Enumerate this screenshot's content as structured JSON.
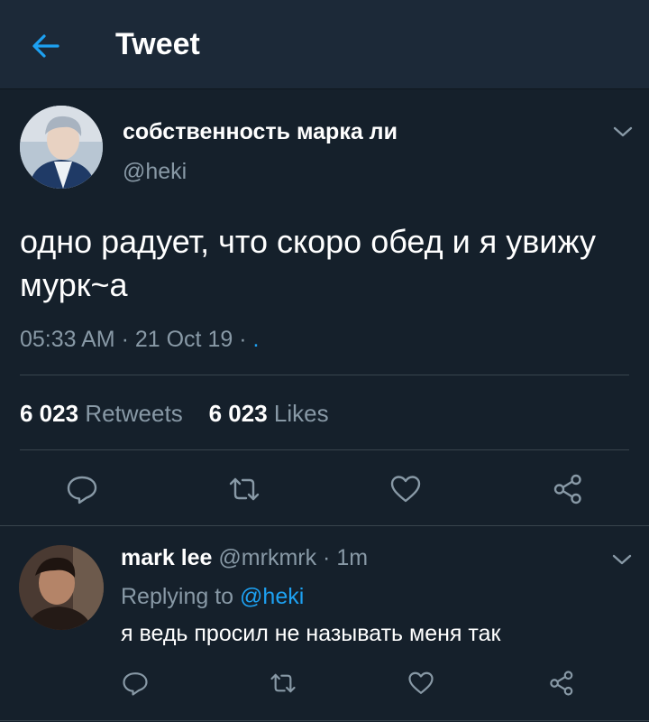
{
  "header": {
    "title": "Tweet"
  },
  "tweet": {
    "author_name": "собственность марка ли",
    "author_handle": "@heki",
    "text": "одно радует, что скоро обед и я увижу мурк~а",
    "time": "05:33 AM",
    "date": "21 Oct 19",
    "meta_sep": " · ",
    "meta_tail": ".",
    "retweets_count": "6 023",
    "retweets_label": "Retweets",
    "likes_count": "6 023",
    "likes_label": "Likes"
  },
  "reply": {
    "author_name": "mark lee",
    "author_handle": "@mrkmrk",
    "age": "1m",
    "replying_label": "Replying to",
    "replying_to": "@heki",
    "text": "я ведь просил не называть меня так"
  },
  "icons": {
    "back": "arrow-left-icon",
    "more": "chevron-down-icon",
    "reply": "speech-bubble-icon",
    "retweet": "retweet-icon",
    "like": "heart-icon",
    "share": "share-icon"
  },
  "colors": {
    "background": "#15202b",
    "header": "#1c2938",
    "accent": "#1da1f2",
    "muted": "#8899a6"
  }
}
